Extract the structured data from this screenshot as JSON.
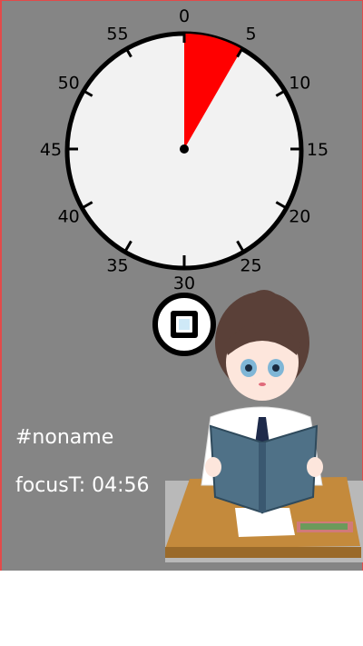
{
  "timer": {
    "dial_numbers": [
      "0",
      "5",
      "10",
      "15",
      "20",
      "25",
      "30",
      "35",
      "40",
      "45",
      "50",
      "55"
    ],
    "elapsed_minutes": 5,
    "wedge_color": "#ff0000",
    "face_color": "#f2f2f2"
  },
  "stop_button": {
    "icon": "stop-icon"
  },
  "task": {
    "name": "#noname"
  },
  "focus": {
    "label": "focusT: 04:56"
  },
  "illustration": {
    "icon": "girl-reading-at-desk"
  },
  "colors": {
    "background": "#858585"
  }
}
